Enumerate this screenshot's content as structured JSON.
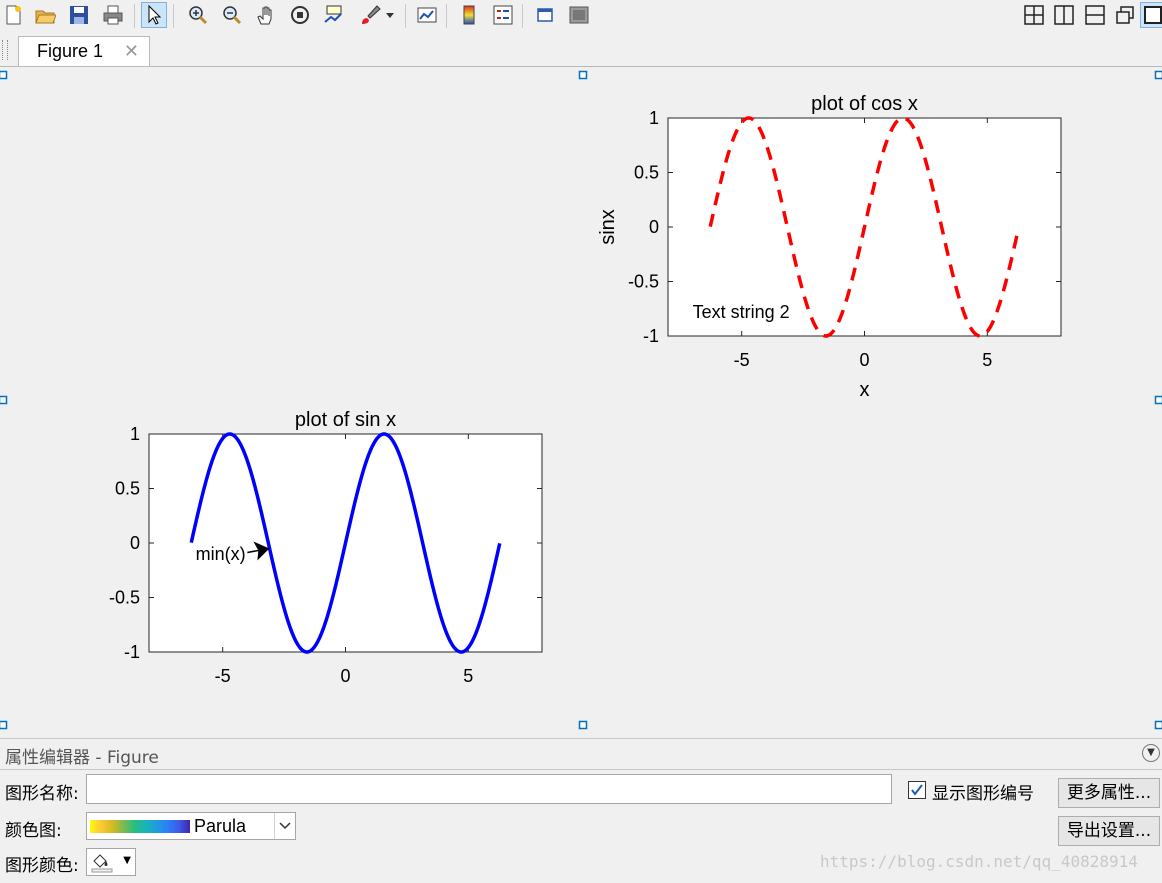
{
  "toolbar": {
    "icons": [
      "new-figure-icon",
      "open-file-icon",
      "save-icon",
      "print-icon",
      "arrow-select-icon",
      "zoom-in-icon",
      "zoom-out-icon",
      "pan-hand-icon",
      "rotate-3d-icon",
      "data-cursor-icon",
      "brush-icon",
      "link-plot-icon",
      "colorbar-icon",
      "legend-icon",
      "hide-tools-icon",
      "show-tools-icon"
    ],
    "layout_icons": [
      "tile-2x2-icon",
      "tile-columns-icon",
      "tile-rows-icon",
      "float-icon",
      "dock-icon"
    ]
  },
  "tab": {
    "label": "Figure 1",
    "close": "✕"
  },
  "chart_data": [
    {
      "type": "line",
      "title": "plot of cos x",
      "xlabel": "x",
      "ylabel": "sinx",
      "xlim": [
        -8,
        8
      ],
      "ylim": [
        -1,
        1
      ],
      "xticks": [
        -5,
        0,
        5
      ],
      "yticks": [
        -1,
        -0.5,
        0,
        0.5,
        1
      ],
      "xtick_labels": [
        "-5",
        "0",
        "5"
      ],
      "ytick_labels": [
        "-1",
        "-0.5",
        "0",
        "0.5",
        "1"
      ],
      "series": [
        {
          "function": "cos(x - pi/2)",
          "x_range": [
            -6.28,
            6.28
          ],
          "color": "#ff0000",
          "style": "dashed"
        }
      ],
      "annotations": [
        {
          "text": "Text string 2",
          "x": -7,
          "y": -0.78
        }
      ]
    },
    {
      "type": "line",
      "title": "plot of sin x",
      "xlabel": "",
      "ylabel": "",
      "xlim": [
        -8,
        8
      ],
      "ylim": [
        -1,
        1
      ],
      "xticks": [
        -5,
        0,
        5
      ],
      "yticks": [
        -1,
        -0.5,
        0,
        0.5,
        1
      ],
      "xtick_labels": [
        "-5",
        "0",
        "5"
      ],
      "ytick_labels": [
        "-1",
        "-0.5",
        "0",
        "0.5",
        "1"
      ],
      "series": [
        {
          "function": "sin(x)",
          "x_range": [
            -6.28,
            6.28
          ],
          "color": "#0000ff",
          "style": "solid"
        }
      ],
      "annotations": [
        {
          "text": "min(x)",
          "x": -6.1,
          "y": -0.1,
          "arrow_to": [
            -3.1,
            -0.05
          ]
        }
      ]
    }
  ],
  "inspector": {
    "title": "属性编辑器 - Figure",
    "name_label": "图形名称:",
    "name_value": "",
    "show_number_label": "显示图形编号",
    "show_number_checked": true,
    "colormap_label": "颜色图:",
    "colormap_value": "Parula",
    "figure_color_label": "图形颜色:",
    "more_props_button": "更多属性...",
    "export_button": "导出设置..."
  },
  "watermark": "https://blog.csdn.net/qq_40828914",
  "colors": {
    "cos_line": "#ff0000",
    "sin_line": "#0000ff",
    "selection_handle": "#0072bd"
  }
}
